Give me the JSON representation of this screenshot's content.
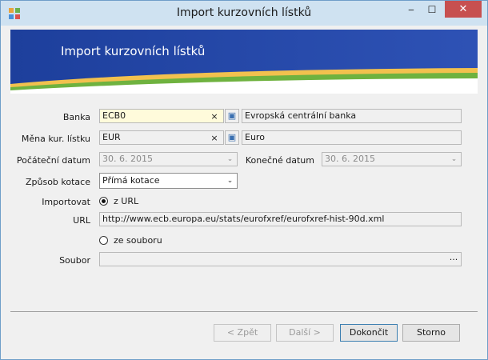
{
  "window": {
    "title": "Import kurzovních lístků"
  },
  "banner": {
    "title": "Import kurzovních lístků"
  },
  "form": {
    "banka": {
      "label": "Banka",
      "code": "ECB0",
      "name": "Evropská centrální banka"
    },
    "mena": {
      "label": "Měna kur. lístku",
      "code": "EUR",
      "name": "Euro"
    },
    "pocatecni": {
      "label": "Počáteční datum",
      "value": "30. 6. 2015"
    },
    "konecne": {
      "label": "Konečné datum",
      "value": "30. 6. 2015"
    },
    "zpusob": {
      "label": "Způsob kotace",
      "value": "Přímá kotace"
    },
    "importovat": {
      "label": "Importovat",
      "option_url": "z URL",
      "option_file": "ze souboru",
      "selected": "url"
    },
    "url": {
      "label": "URL",
      "value": "http://www.ecb.europa.eu/stats/eurofxref/eurofxref-hist-90d.xml"
    },
    "soubor": {
      "label": "Soubor",
      "value": "",
      "browse": "···"
    }
  },
  "buttons": {
    "back": "< Zpět",
    "next": "Další >",
    "finish": "Dokončit",
    "cancel": "Storno"
  },
  "icons": {
    "clear": "×",
    "lookup": "▣",
    "dropdown": "⌄",
    "minimize": "‒",
    "maximize": "☐",
    "close": "✕"
  }
}
